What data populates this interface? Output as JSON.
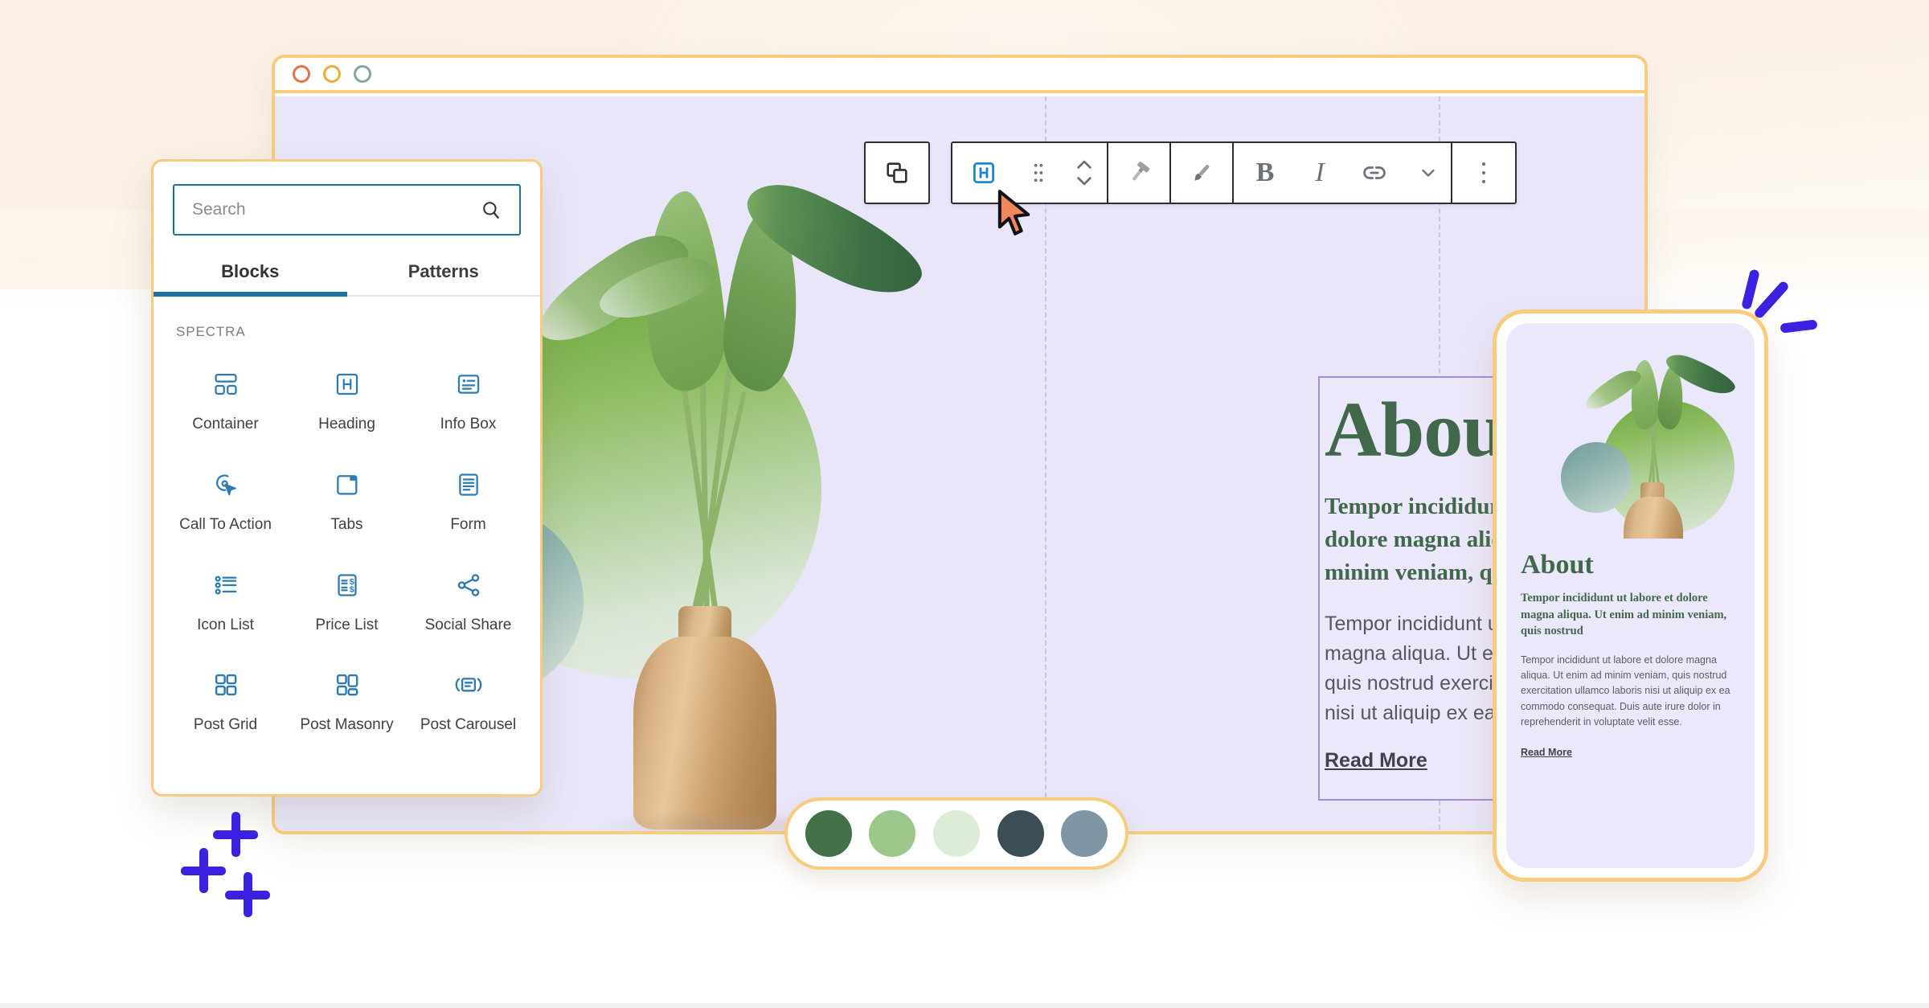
{
  "window": {
    "dots": [
      "close-dot",
      "minimize-dot",
      "maximize-dot"
    ]
  },
  "inserter": {
    "search": {
      "value": "",
      "placeholder": "Search",
      "icon": "search-icon"
    },
    "tabs": [
      {
        "label": "Blocks",
        "active": true
      },
      {
        "label": "Patterns",
        "active": false
      }
    ],
    "section_label": "SPECTRA",
    "blocks": [
      {
        "label": "Container",
        "icon": "container-icon"
      },
      {
        "label": "Heading",
        "icon": "heading-icon"
      },
      {
        "label": "Info Box",
        "icon": "info-box-icon"
      },
      {
        "label": "Call To Action",
        "icon": "call-to-action-icon"
      },
      {
        "label": "Tabs",
        "icon": "tabs-icon"
      },
      {
        "label": "Form",
        "icon": "form-icon"
      },
      {
        "label": "Icon List",
        "icon": "icon-list-icon"
      },
      {
        "label": "Price List",
        "icon": "price-list-icon"
      },
      {
        "label": "Social Share",
        "icon": "social-share-icon"
      },
      {
        "label": "Post Grid",
        "icon": "post-grid-icon"
      },
      {
        "label": "Post Masonry",
        "icon": "post-masonry-icon"
      },
      {
        "label": "Post Carousel",
        "icon": "post-carousel-icon"
      }
    ]
  },
  "toolbar": {
    "select_parent": "select-parent-icon",
    "buttons": [
      {
        "name": "block-type-heading",
        "icon": "heading-block-icon",
        "label": "H"
      },
      {
        "name": "drag-handle",
        "icon": "drag-dots-icon"
      },
      {
        "name": "move-updown",
        "icon": "move-up-down-icon"
      },
      {
        "name": "paint-roller",
        "icon": "paint-roller-icon"
      },
      {
        "name": "paint-brush",
        "icon": "paint-brush-icon"
      },
      {
        "name": "bold",
        "icon": "bold-icon",
        "label": "B"
      },
      {
        "name": "italic",
        "icon": "italic-icon",
        "label": "I"
      },
      {
        "name": "link",
        "icon": "link-icon"
      },
      {
        "name": "more-formats",
        "icon": "chevron-down-icon"
      },
      {
        "name": "block-options",
        "icon": "ellipsis-vertical-icon"
      }
    ]
  },
  "canvas": {
    "about": {
      "title": "About",
      "subtitle": "Tempor incididunt ut labore et dolore magna aliqua. Ut enim ad minim veniam, quis nostrud",
      "body": "Tempor incididunt ut labore et dolore magna aliqua. Ut enim ad minim veniam, quis nostrud exercitation ullamco laboris nisi ut aliquip ex ea commodo.",
      "link": "Read More"
    }
  },
  "mobile_preview": {
    "title": "About",
    "subtitle": "Tempor incididunt ut labore et dolore magna aliqua. Ut enim ad minim veniam, quis nostrud",
    "body": "Tempor incididunt ut labore et dolore magna aliqua. Ut enim ad minim veniam, quis nostrud exercitation ullamco laboris nisi ut aliquip ex ea commodo consequat. Duis aute irure dolor in reprehenderit in voluptate velit esse.",
    "link": "Read More"
  },
  "palette": {
    "swatches": [
      {
        "name": "swatch-dark-green",
        "color": "#437046"
      },
      {
        "name": "swatch-light-green",
        "color": "#9dc68a"
      },
      {
        "name": "swatch-pale-green",
        "color": "#dcecd6"
      },
      {
        "name": "swatch-dark-slate",
        "color": "#3c4e55"
      },
      {
        "name": "swatch-blue-gray",
        "color": "#7e96a3"
      }
    ]
  },
  "theme": {
    "accent_orange": "#f8cb7f",
    "canvas_purple": "#eae6fa",
    "heading_green": "#41684b",
    "selection_purple": "#a78bdb",
    "tab_blue": "#1d71a8",
    "decor_blue": "#3a22e0"
  }
}
